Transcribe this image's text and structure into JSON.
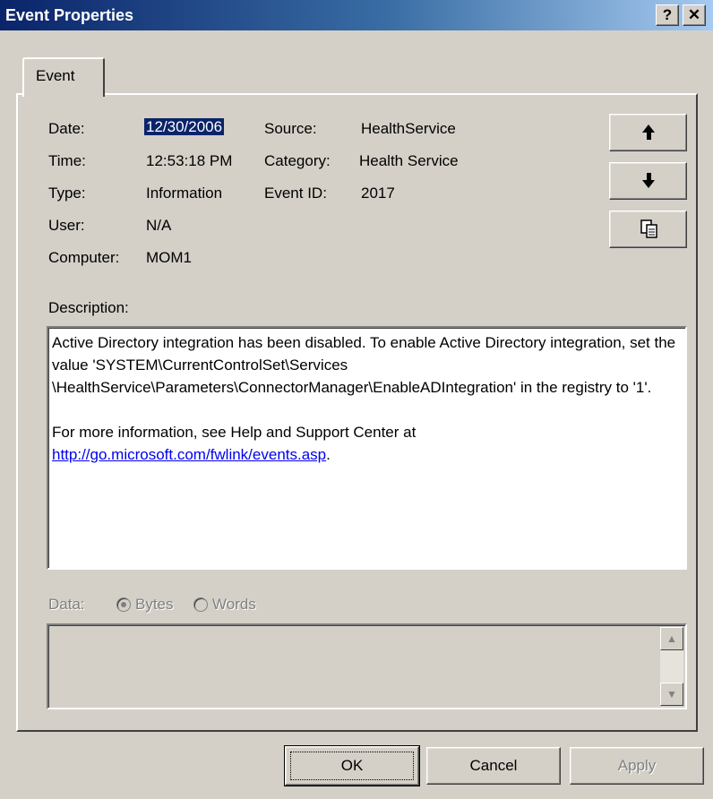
{
  "window": {
    "title": "Event Properties",
    "help_glyph": "?",
    "close_glyph": "✕"
  },
  "tabs": [
    {
      "label": "Event"
    }
  ],
  "fields": {
    "date_label": "Date:",
    "date_value": "12/30/2006",
    "time_label": "Time:",
    "time_value": "12:53:18 PM",
    "type_label": "Type:",
    "type_value": "Information",
    "user_label": "User:",
    "user_value": "N/A",
    "computer_label": "Computer:",
    "computer_value": "MOM1",
    "source_label": "Source:",
    "source_value": "HealthService",
    "category_label": "Category:",
    "category_value": "Health Service",
    "eventid_label": "Event ID:",
    "eventid_value": "2017"
  },
  "nav_buttons": {
    "up_glyph": "🡅",
    "down_glyph": "🡇",
    "copy_icon": "copy-icon"
  },
  "description": {
    "label": "Description:",
    "line1": "Active Directory integration has been disabled.  To enable Active Directory integration, set the value 'SYSTEM\\CurrentControlSet\\Services \\HealthService\\Parameters\\ConnectorManager\\EnableADIntegration' in the registry to '1'.",
    "line2": "For more information, see Help and Support Center at",
    "link": "http://go.microsoft.com/fwlink/events.asp",
    "link_suffix": "."
  },
  "data_section": {
    "label": "Data:",
    "bytes_label": "Bytes",
    "words_label": "Words",
    "selected": "Bytes"
  },
  "footer": {
    "ok_label": "OK",
    "cancel_label": "Cancel",
    "apply_label": "Apply"
  },
  "colors": {
    "title_bar": "#0a246a",
    "face": "#d4d0c8",
    "selection": "#0a246a",
    "link": "#0000ee"
  }
}
